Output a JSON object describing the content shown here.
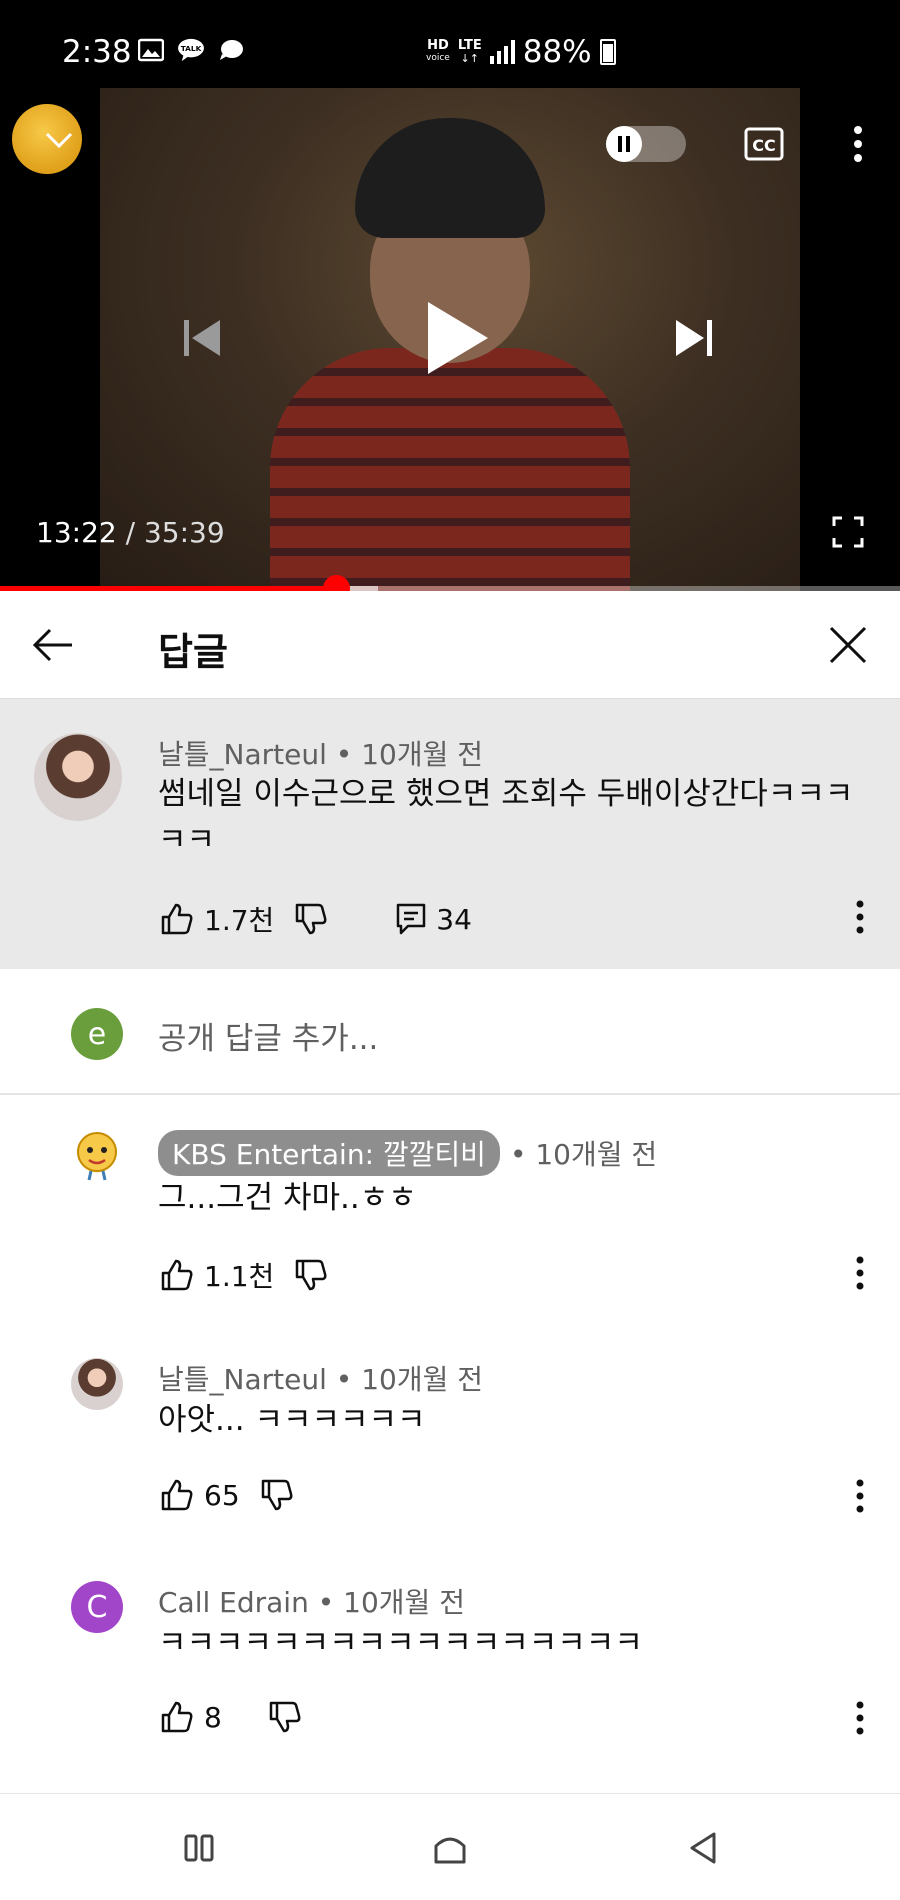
{
  "status_bar": {
    "time": "2:38",
    "hd_label": "HD",
    "voice_label": "voice",
    "lte_label": "LTE",
    "battery": "88%",
    "icons": [
      "gallery-icon",
      "kakaotalk-icon",
      "chat-bubble-icon"
    ]
  },
  "player": {
    "current_time": "13:22",
    "separator": " / ",
    "duration": "35:39",
    "progress": 0.373,
    "buffered": 0.42,
    "accent_color": "#ff0000",
    "icons": [
      "collapse-icon",
      "pause-icon",
      "cc-icon",
      "more-vert-icon",
      "skip-previous-icon",
      "play-icon",
      "skip-next-icon",
      "fullscreen-icon"
    ]
  },
  "replies_header": {
    "title": "답글"
  },
  "parent_comment": {
    "author": "날틀_Narteul",
    "time": "• 10개월 전",
    "text": "썸네일 이수근으로 했으면 조회수 두배이상간다ㅋㅋㅋㅋㅋ",
    "likes": "1.7천",
    "reply_count": "34"
  },
  "add_reply": {
    "avatar_letter": "e",
    "avatar_color": "#6a9e3c",
    "placeholder": "공개 답글 추가..."
  },
  "replies": [
    {
      "author": "KBS Entertain: 깔깔티비",
      "author_is_creator": true,
      "time": "• 10개월 전",
      "text": "그...그건 차마..ㅎㅎ",
      "likes": "1.1천"
    },
    {
      "author": "날틀_Narteul",
      "author_is_creator": false,
      "time": "• 10개월 전",
      "text": "아앗... ㅋㅋㅋㅋㅋㅋ",
      "likes": "65"
    },
    {
      "author": "Call Edrain",
      "author_is_creator": false,
      "avatar_letter": "C",
      "avatar_color": "#a246c9",
      "time": "• 10개월 전",
      "text": "ㅋㅋㅋㅋㅋㅋㅋㅋㅋㅋㅋㅋㅋㅋㅋㅋㅋ",
      "likes": "8"
    }
  ],
  "nav_bar": {
    "icons": [
      "recent-apps-icon",
      "home-icon",
      "back-icon"
    ]
  }
}
